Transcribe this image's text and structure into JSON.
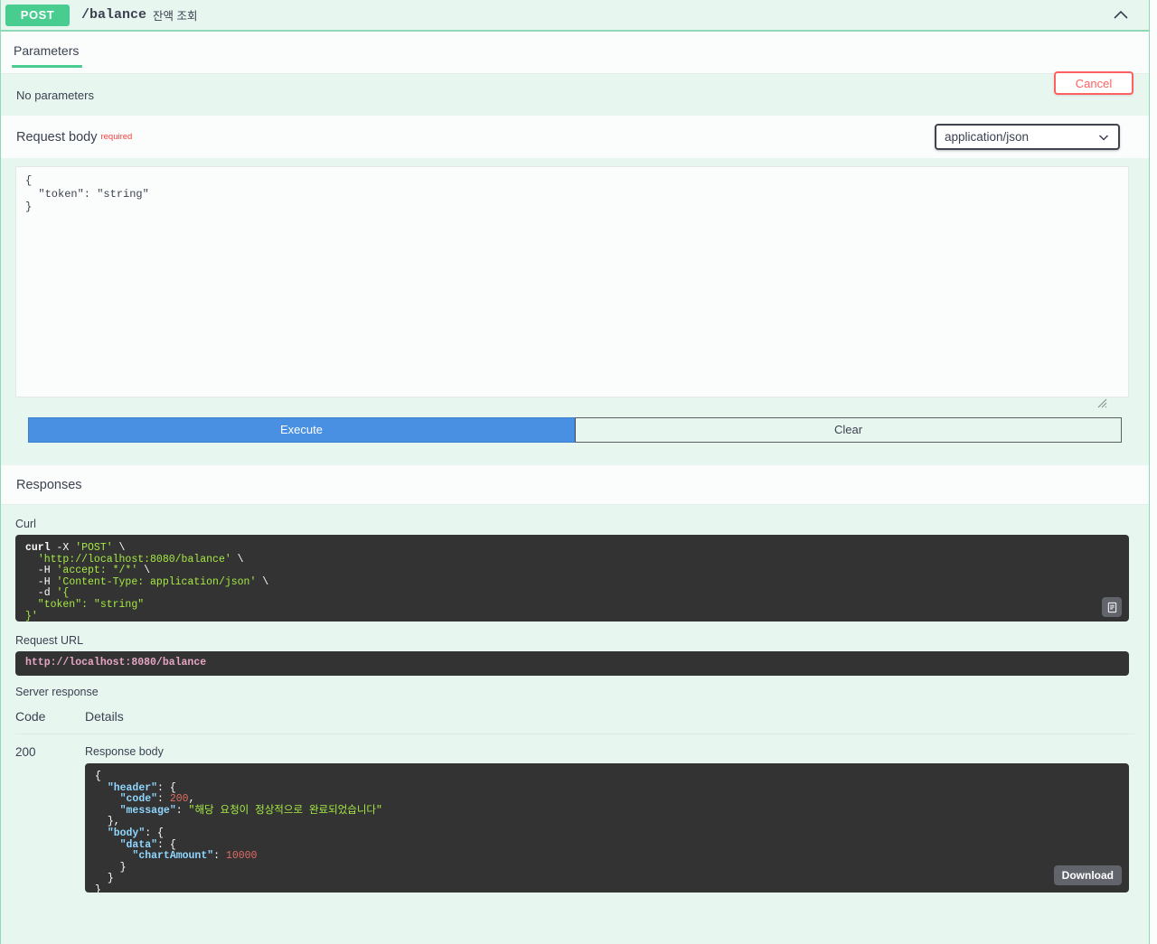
{
  "operation": {
    "method": "POST",
    "path": "/balance",
    "summary": "잔액 조회",
    "collapse_icon": "chevron-up-icon"
  },
  "tabs": [
    {
      "label": "Parameters",
      "active": true
    }
  ],
  "cancel_button": "Cancel",
  "parameters": {
    "empty_text": "No parameters"
  },
  "request_body": {
    "title": "Request body",
    "required_tag": "required",
    "media_type": {
      "selected": "application/json",
      "options": [
        "application/json"
      ],
      "icon": "chevron-down-icon"
    },
    "editor_value": "{\n  \"token\": \"string\"\n}"
  },
  "actions": {
    "execute": "Execute",
    "clear": "Clear"
  },
  "responses": {
    "heading": "Responses",
    "curl_label": "Curl",
    "curl": {
      "line1_cmd": "curl",
      "line1_flag": " -X ",
      "line1_method": "'POST'",
      "line1_cont": " \\",
      "line2_url": "'http://localhost:8080/balance'",
      "line2_cont": " \\",
      "line3_flag": "  -H ",
      "line3_val": "'accept: */*'",
      "line3_cont": " \\",
      "line4_flag": "  -H ",
      "line4_val": "'Content-Type: application/json'",
      "line4_cont": " \\",
      "line5_flag": "  -d ",
      "line5_val": "'{",
      "line6": "  \"token\": \"string\"",
      "line7": "}'"
    },
    "request_url_label": "Request URL",
    "request_url": "http://localhost:8080/balance",
    "server_response_label": "Server response",
    "table_headers": {
      "code": "Code",
      "details": "Details"
    },
    "row": {
      "code": "200",
      "response_body_label": "Response body",
      "body_lines": {
        "l1": "{",
        "l2_key": "\"header\"",
        "l2_rest": ": {",
        "l3_key": "\"code\"",
        "l3_sep": ": ",
        "l3_num": "200",
        "l3_comma": ",",
        "l4_key": "\"message\"",
        "l4_sep": ": ",
        "l4_val": "\"해당 요청이 정상적으로 완료되었습니다\"",
        "l5": "},",
        "l6_key": "\"body\"",
        "l6_rest": ": {",
        "l7_key": "\"data\"",
        "l7_rest": ": {",
        "l8_key": "\"chartAmount\"",
        "l8_sep": ": ",
        "l8_num": "10000",
        "l9": "}",
        "l10": "}",
        "l11": "}"
      }
    },
    "copy_icon": "clipboard-copy-icon",
    "download_button": "Download"
  }
}
